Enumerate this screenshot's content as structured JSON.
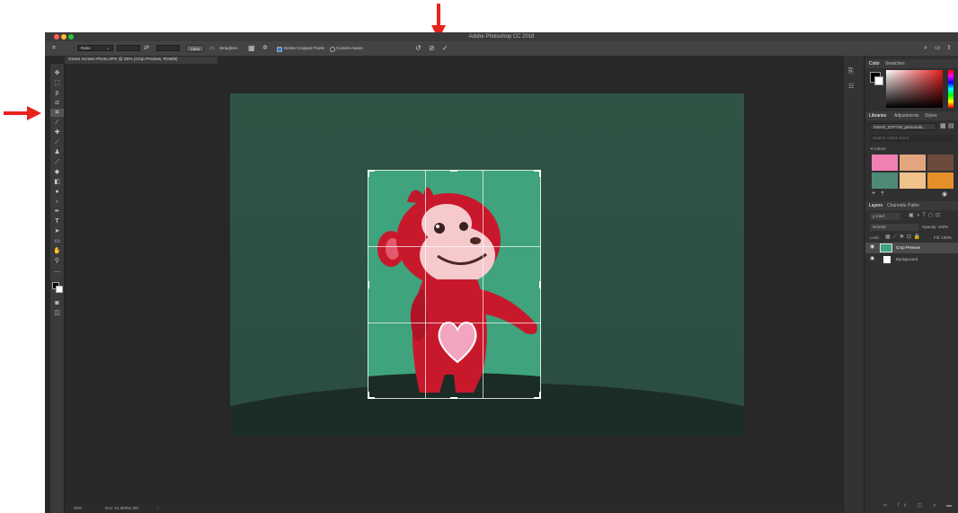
{
  "app": {
    "title": "Adobe Photoshop CC 2018"
  },
  "options_bar": {
    "ratio": "Ratio",
    "clear": "Clear",
    "straighten": "Straighten",
    "delete_cropped": "Delete Cropped Pixels",
    "content_aware": "Content-Aware",
    "reset_glyph": "↺",
    "cancel_glyph": "⊘",
    "commit_glyph": "✓"
  },
  "document": {
    "tab": "Green Screen Photo.JPG @ 25% (Crop Preview, RGB/8)"
  },
  "status": {
    "zoom": "25%",
    "doc": "Doc: 51.3M/51.3M"
  },
  "panels": {
    "color_tabs": [
      "Color",
      "Swatches"
    ],
    "library_tabs": [
      "Libraries",
      "Adjustments",
      "Styles"
    ],
    "library_name": "OSHO_DYFYW_personalit...",
    "library_search": "Search Adobe Stock",
    "colors_heading": "▾ Colors",
    "swatches": [
      "#f07fb4",
      "#e3a57d",
      "#6b4a3e",
      "#4f8a78",
      "#efc28c",
      "#e3902a"
    ],
    "layer_tabs": [
      "Layers",
      "Channels",
      "Paths"
    ],
    "kind": "ρ Kind",
    "blend": "Normal",
    "opacity": "Opacity: 100%",
    "lock": "Lock:",
    "fill": "Fill: 100%",
    "layers": [
      {
        "name": "Crop Preview",
        "selected": true
      },
      {
        "name": "Background",
        "selected": false
      }
    ]
  },
  "annotations": {
    "arrow_color": "#e8231c"
  }
}
